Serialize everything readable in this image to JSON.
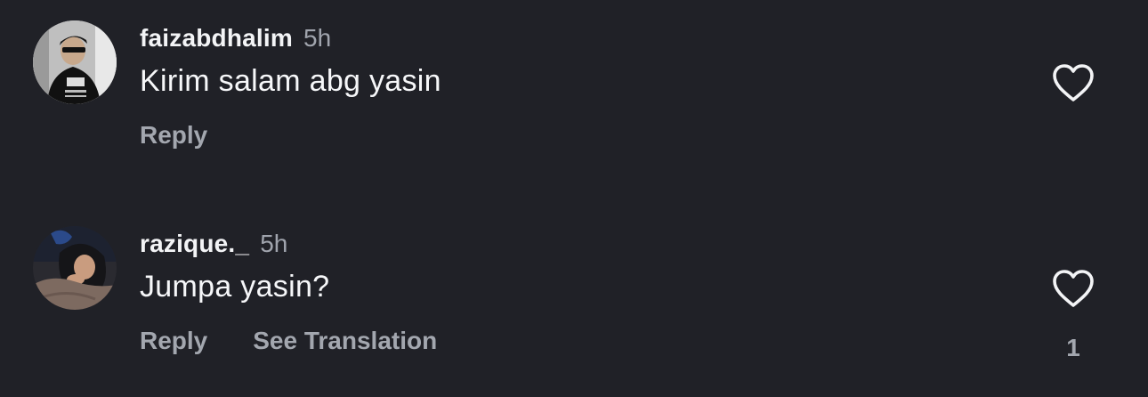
{
  "theme": {
    "background": "#202127",
    "text_primary": "#f6f7f9",
    "text_secondary": "#a3a7af"
  },
  "comments": [
    {
      "avatar_icon": "user-avatar-faizabdhalim",
      "username": "faizabdhalim",
      "timestamp": "5h",
      "text": "Kirim salam abg yasin",
      "actions": {
        "reply": "Reply"
      },
      "like_icon": "heart-outline-icon",
      "like_count": ""
    },
    {
      "avatar_icon": "user-avatar-razique",
      "username": "razique._",
      "timestamp": "5h",
      "text": "Jumpa yasin?",
      "actions": {
        "reply": "Reply",
        "translate": "See Translation"
      },
      "like_icon": "heart-outline-icon",
      "like_count": "1"
    }
  ]
}
